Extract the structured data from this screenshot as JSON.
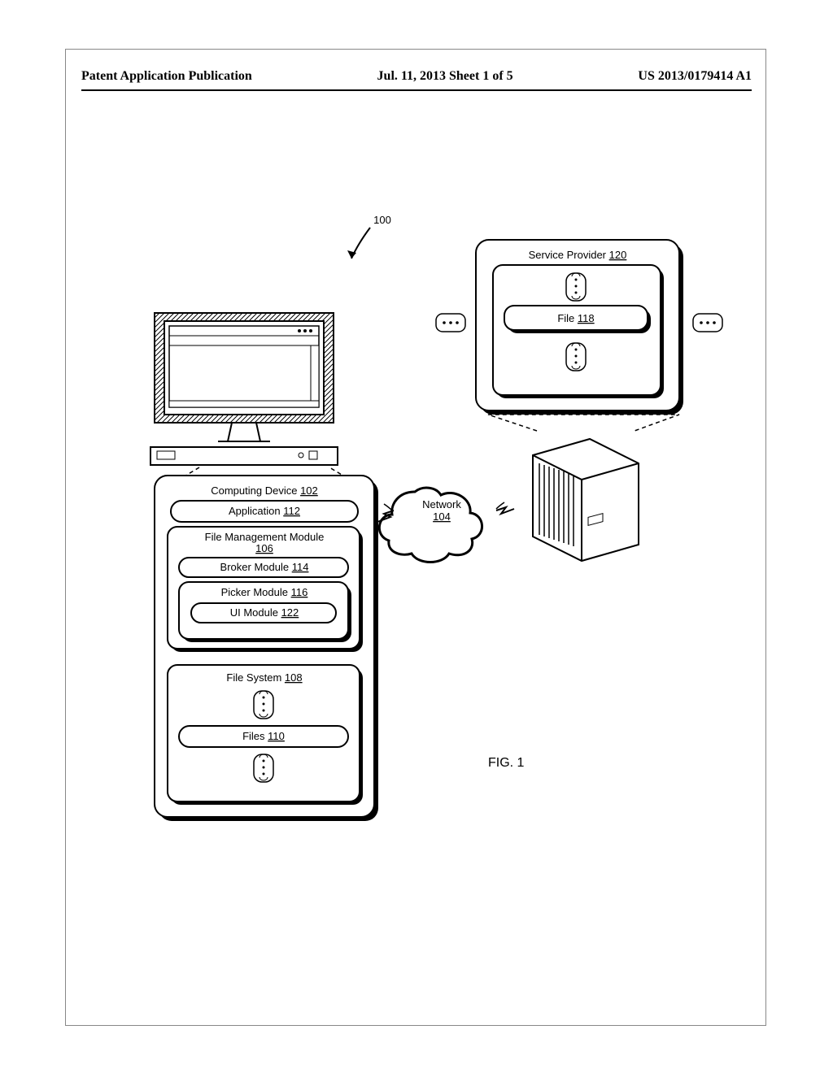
{
  "header": {
    "left": "Patent Application Publication",
    "center": "Jul. 11, 2013  Sheet 1 of 5",
    "right": "US 2013/0179414 A1"
  },
  "figure": {
    "ref_num": "100",
    "caption": "FIG. 1",
    "network": {
      "label": "Network",
      "num": "104"
    },
    "device": {
      "title": "Computing Device",
      "num": "102",
      "application": {
        "label": "Application",
        "num": "112"
      },
      "fmm": {
        "label": "File Management Module",
        "num": "106"
      },
      "broker": {
        "label": "Broker Module",
        "num": "114"
      },
      "picker": {
        "label": "Picker Module",
        "num": "116"
      },
      "ui": {
        "label": "UI Module",
        "num": "122"
      },
      "filesystem": {
        "label": "File System",
        "num": "108"
      },
      "files": {
        "label": "Files",
        "num": "110"
      }
    },
    "provider": {
      "title": "Service Provider",
      "num": "120",
      "file": {
        "label": "File",
        "num": "118"
      }
    }
  }
}
